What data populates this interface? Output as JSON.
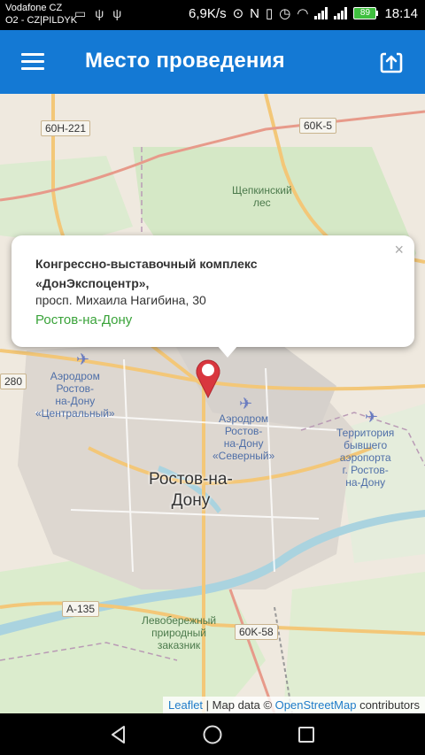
{
  "status_bar": {
    "carrier_line1": "Vodafone CZ",
    "carrier_line2": "O2 - CZ|PILDYK",
    "speed": "6,9K/s",
    "battery": "89",
    "time": "18:14"
  },
  "app_bar": {
    "title": "Место проведения",
    "menu_icon": "hamburger-menu-icon",
    "action_icon": "open-external-icon"
  },
  "map": {
    "roads": [
      "60H-221",
      "60K-5",
      "280",
      "A-135",
      "60K-58"
    ],
    "places": {
      "forest": "Щепкинский\nлес",
      "airport_central": "Аэродром\nРостов-\nна-Дону\n«Центральный»",
      "airport_north": "Аэродром\nРостов-\nна-Дону\n«Северный»",
      "former_airport": "Территория\nбывшего\nаэропорта\nг. Ростов-\nна-Дону",
      "reserve": "Левобережный\nприродный\nзаказник",
      "city": "Ростов-на-\nДону"
    }
  },
  "popup": {
    "name_line1": "Конгрессно-выставочный комплекс",
    "name_line2": "«ДонЭкспоцентр»,",
    "address": "просп. Михаила Нагибина, 30",
    "city": "Ростов-на-Дону",
    "close": "×"
  },
  "attribution": {
    "leaflet": "Leaflet",
    "sep": " | Map data © ",
    "osm": "OpenStreetMap",
    "suffix": " contributors"
  },
  "colors": {
    "app_bar": "#1479d4",
    "city_link": "#3aa33a",
    "marker": "#d9363e"
  }
}
